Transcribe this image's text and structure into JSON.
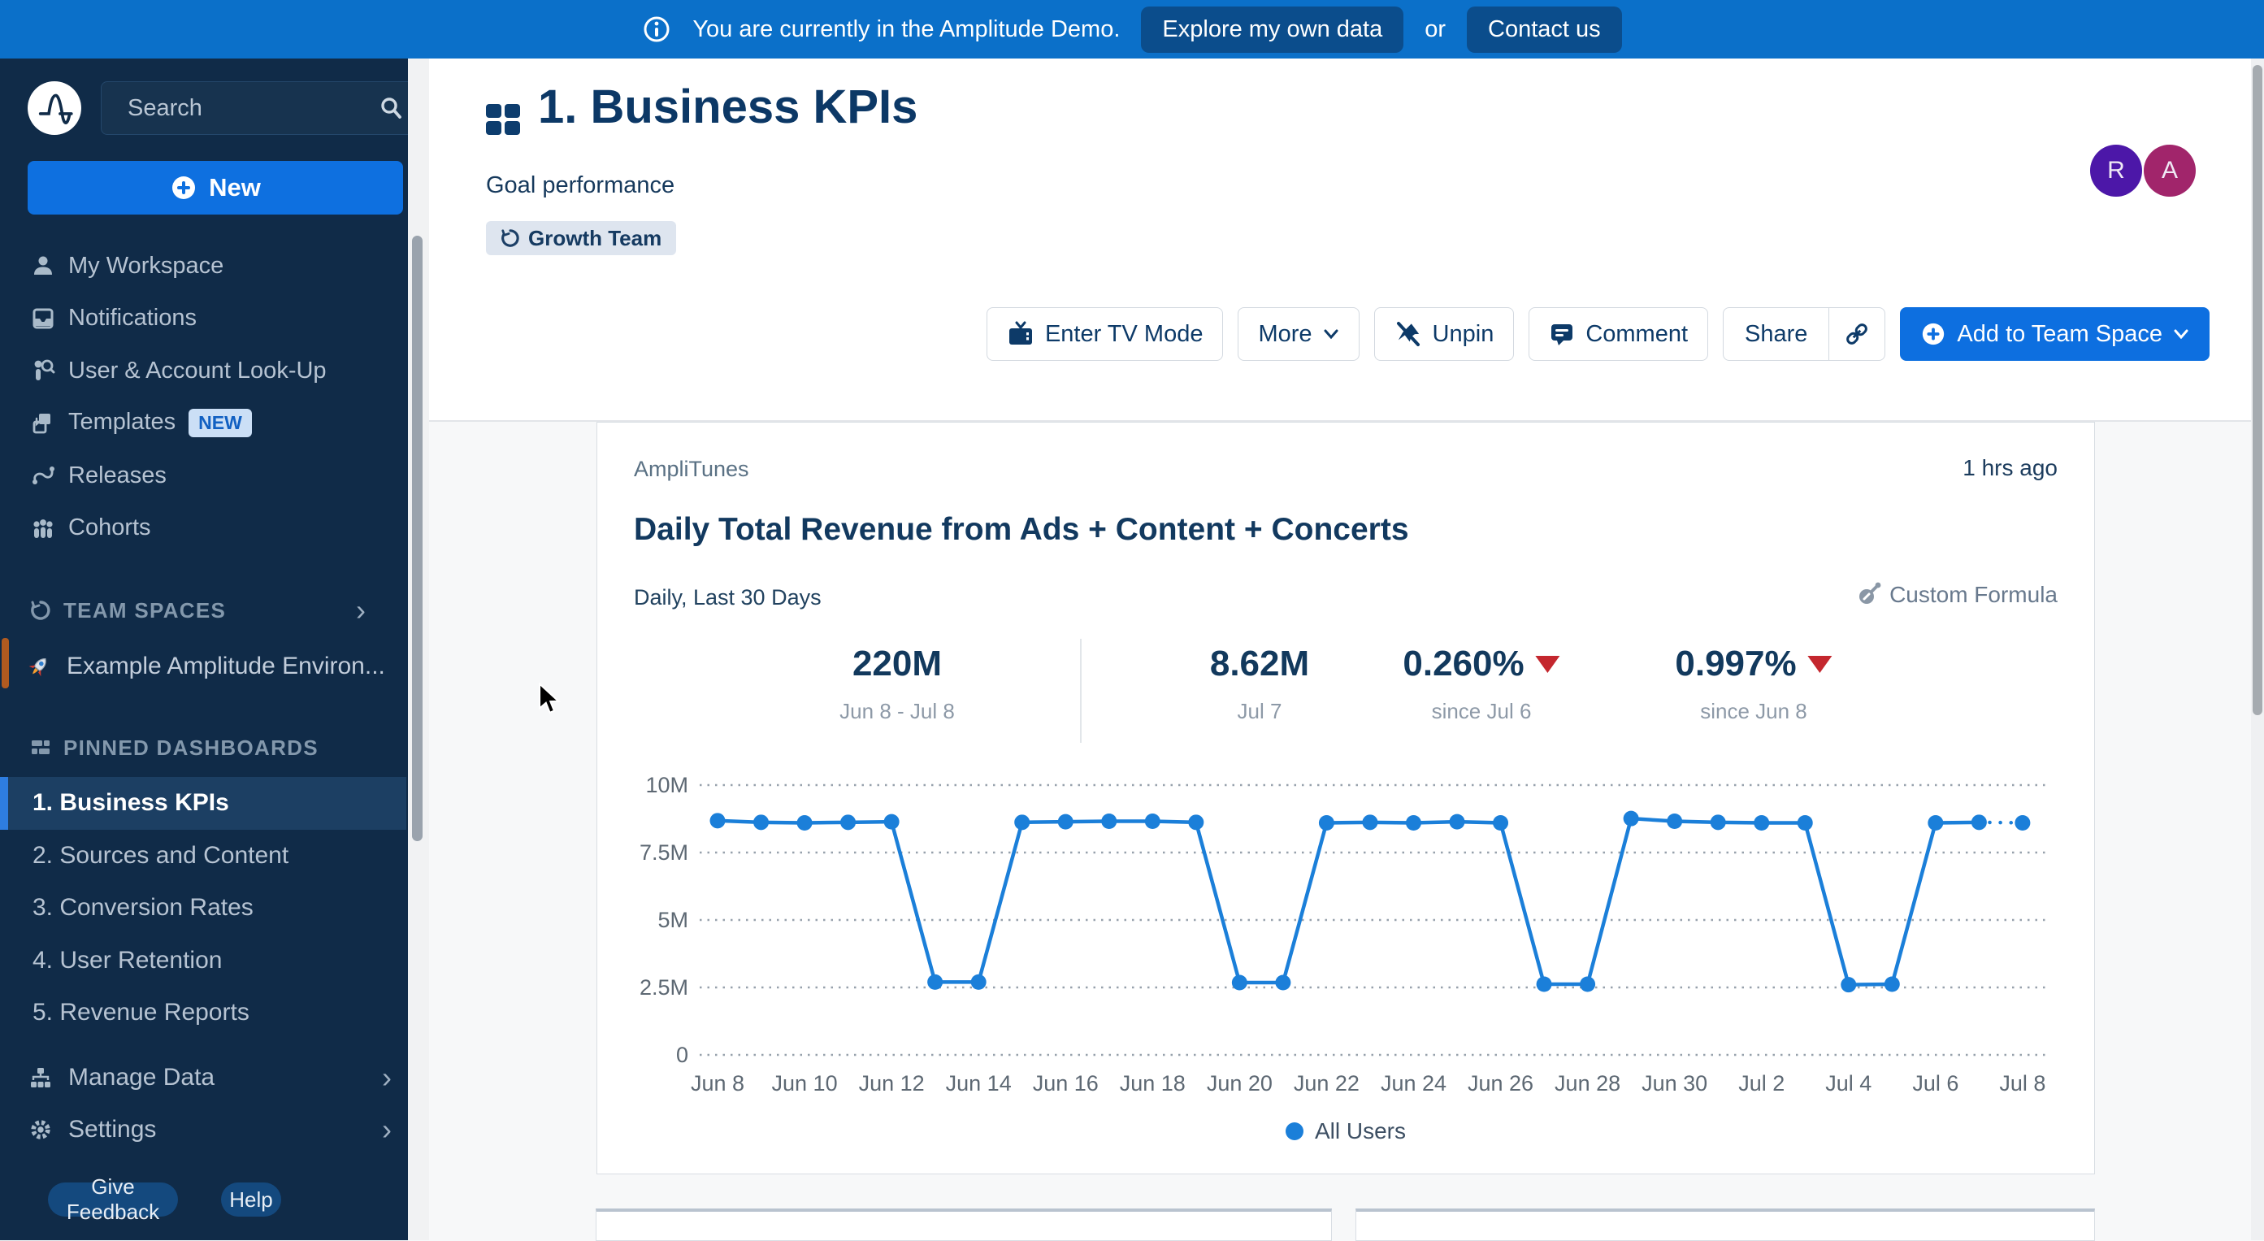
{
  "banner": {
    "message": "You are currently in the Amplitude Demo.",
    "explore_label": "Explore my own data",
    "or_label": "or",
    "contact_label": "Contact us"
  },
  "sidebar": {
    "search_placeholder": "Search",
    "new_label": "New",
    "items": [
      {
        "label": "My Workspace"
      },
      {
        "label": "Notifications"
      },
      {
        "label": "User & Account Look-Up"
      },
      {
        "label": "Templates",
        "badge": "NEW"
      },
      {
        "label": "Releases"
      },
      {
        "label": "Cohorts"
      }
    ],
    "team_spaces_header": "TEAM SPACES",
    "team_space_item": "Example Amplitude Environ...",
    "pinned_header": "PINNED DASHBOARDS",
    "dashboards": [
      {
        "label": "1. Business KPIs",
        "selected": true
      },
      {
        "label": "2. Sources and Content"
      },
      {
        "label": "3. Conversion Rates"
      },
      {
        "label": "4. User Retention"
      },
      {
        "label": "5. Revenue Reports"
      }
    ],
    "manage_data_label": "Manage Data",
    "settings_label": "Settings",
    "give_feedback_label": "Give Feedback",
    "help_label": "Help"
  },
  "header": {
    "title": "1. Business KPIs",
    "subtitle": "Goal performance",
    "team_chip": "Growth Team",
    "avatars": [
      {
        "initial": "R",
        "color": "#4c17a8"
      },
      {
        "initial": "A",
        "color": "#a1256b"
      }
    ],
    "toolbar": {
      "tv_label": "Enter TV Mode",
      "more_label": "More",
      "unpin_label": "Unpin",
      "comment_label": "Comment",
      "share_label": "Share",
      "add_label": "Add to Team Space"
    }
  },
  "card": {
    "app_label": "AmpliTunes",
    "updated": "1 hrs ago",
    "title": "Daily Total Revenue from Ads + Content + Concerts",
    "range_label": "Daily, Last 30 Days",
    "custom_formula_label": "Custom Formula",
    "stats": [
      {
        "value": "220M",
        "label": "Jun 8 - Jul 8",
        "trend": null
      },
      {
        "value": "8.62M",
        "label": "Jul 7",
        "trend": null
      },
      {
        "value": "0.260%",
        "label": "since Jul 6",
        "trend": "down"
      },
      {
        "value": "0.997%",
        "label": "since Jun 8",
        "trend": "down"
      }
    ],
    "trend_color": "#c4272e"
  },
  "chart_data": {
    "type": "line",
    "title": "Daily Total Revenue from Ads + Content + Concerts",
    "x_labels": [
      "Jun 8",
      "Jun 9",
      "Jun 10",
      "Jun 11",
      "Jun 12",
      "Jun 13",
      "Jun 14",
      "Jun 15",
      "Jun 16",
      "Jun 17",
      "Jun 18",
      "Jun 19",
      "Jun 20",
      "Jun 21",
      "Jun 22",
      "Jun 23",
      "Jun 24",
      "Jun 25",
      "Jun 26",
      "Jun 27",
      "Jun 28",
      "Jun 29",
      "Jun 30",
      "Jul 1",
      "Jul 2",
      "Jul 3",
      "Jul 4",
      "Jul 5",
      "Jul 6",
      "Jul 7",
      "Jul 8"
    ],
    "tick_every": 2,
    "series": [
      {
        "name": "All Users",
        "color": "#1b7fd9",
        "unit": "M",
        "values": [
          8.68,
          8.62,
          8.6,
          8.62,
          8.64,
          2.7,
          2.7,
          8.62,
          8.64,
          8.66,
          8.66,
          8.62,
          2.68,
          2.68,
          8.6,
          8.62,
          8.6,
          8.64,
          8.6,
          2.62,
          2.62,
          8.76,
          8.66,
          8.62,
          8.6,
          8.6,
          2.6,
          2.62,
          8.6,
          8.62,
          8.6
        ]
      }
    ],
    "ylim": [
      0,
      10
    ],
    "y_ticks": [
      0,
      2.5,
      5,
      7.5,
      10
    ],
    "y_tick_labels": [
      "0",
      "2.5M",
      "5M",
      "7.5M",
      "10M"
    ],
    "grid": "dotted-horizontal",
    "last_segment": "dotted",
    "legend_position": "bottom-center"
  }
}
